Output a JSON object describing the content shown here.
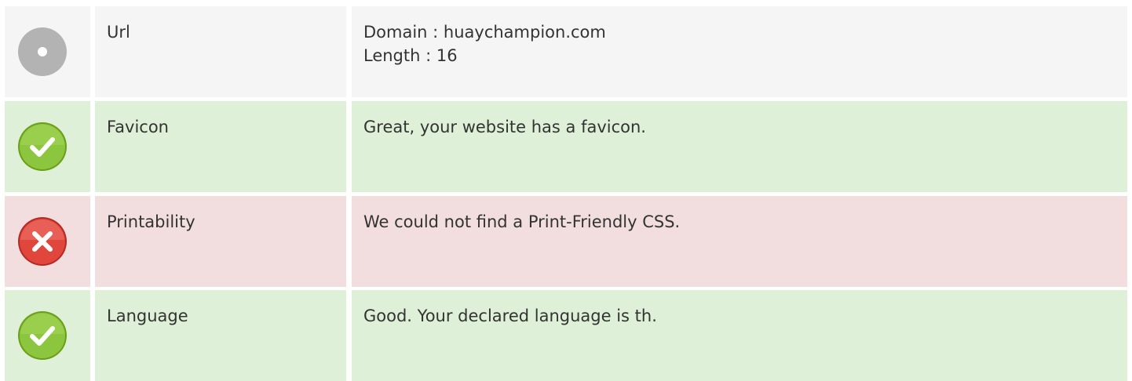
{
  "rows": [
    {
      "status": "neutral",
      "icon": "neutral-dot-icon",
      "label": "Url",
      "value_lines": [
        "Domain : huaychampion.com",
        "Length : 16"
      ]
    },
    {
      "status": "success",
      "icon": "check-circle-icon",
      "label": "Favicon",
      "value_lines": [
        "Great, your website has a favicon."
      ]
    },
    {
      "status": "danger",
      "icon": "error-circle-icon",
      "label": "Printability",
      "value_lines": [
        "We could not find a Print-Friendly CSS."
      ]
    },
    {
      "status": "success",
      "icon": "check-circle-icon",
      "label": "Language",
      "value_lines": [
        "Good. Your declared language is th."
      ]
    }
  ],
  "colors": {
    "neutral_bg": "#f5f5f5",
    "success_bg": "#dff0d8",
    "danger_bg": "#f2dede",
    "success_icon": "#7ab51d",
    "danger_icon": "#d9362b",
    "neutral_icon": "#b3b3b3",
    "text": "#333333"
  }
}
